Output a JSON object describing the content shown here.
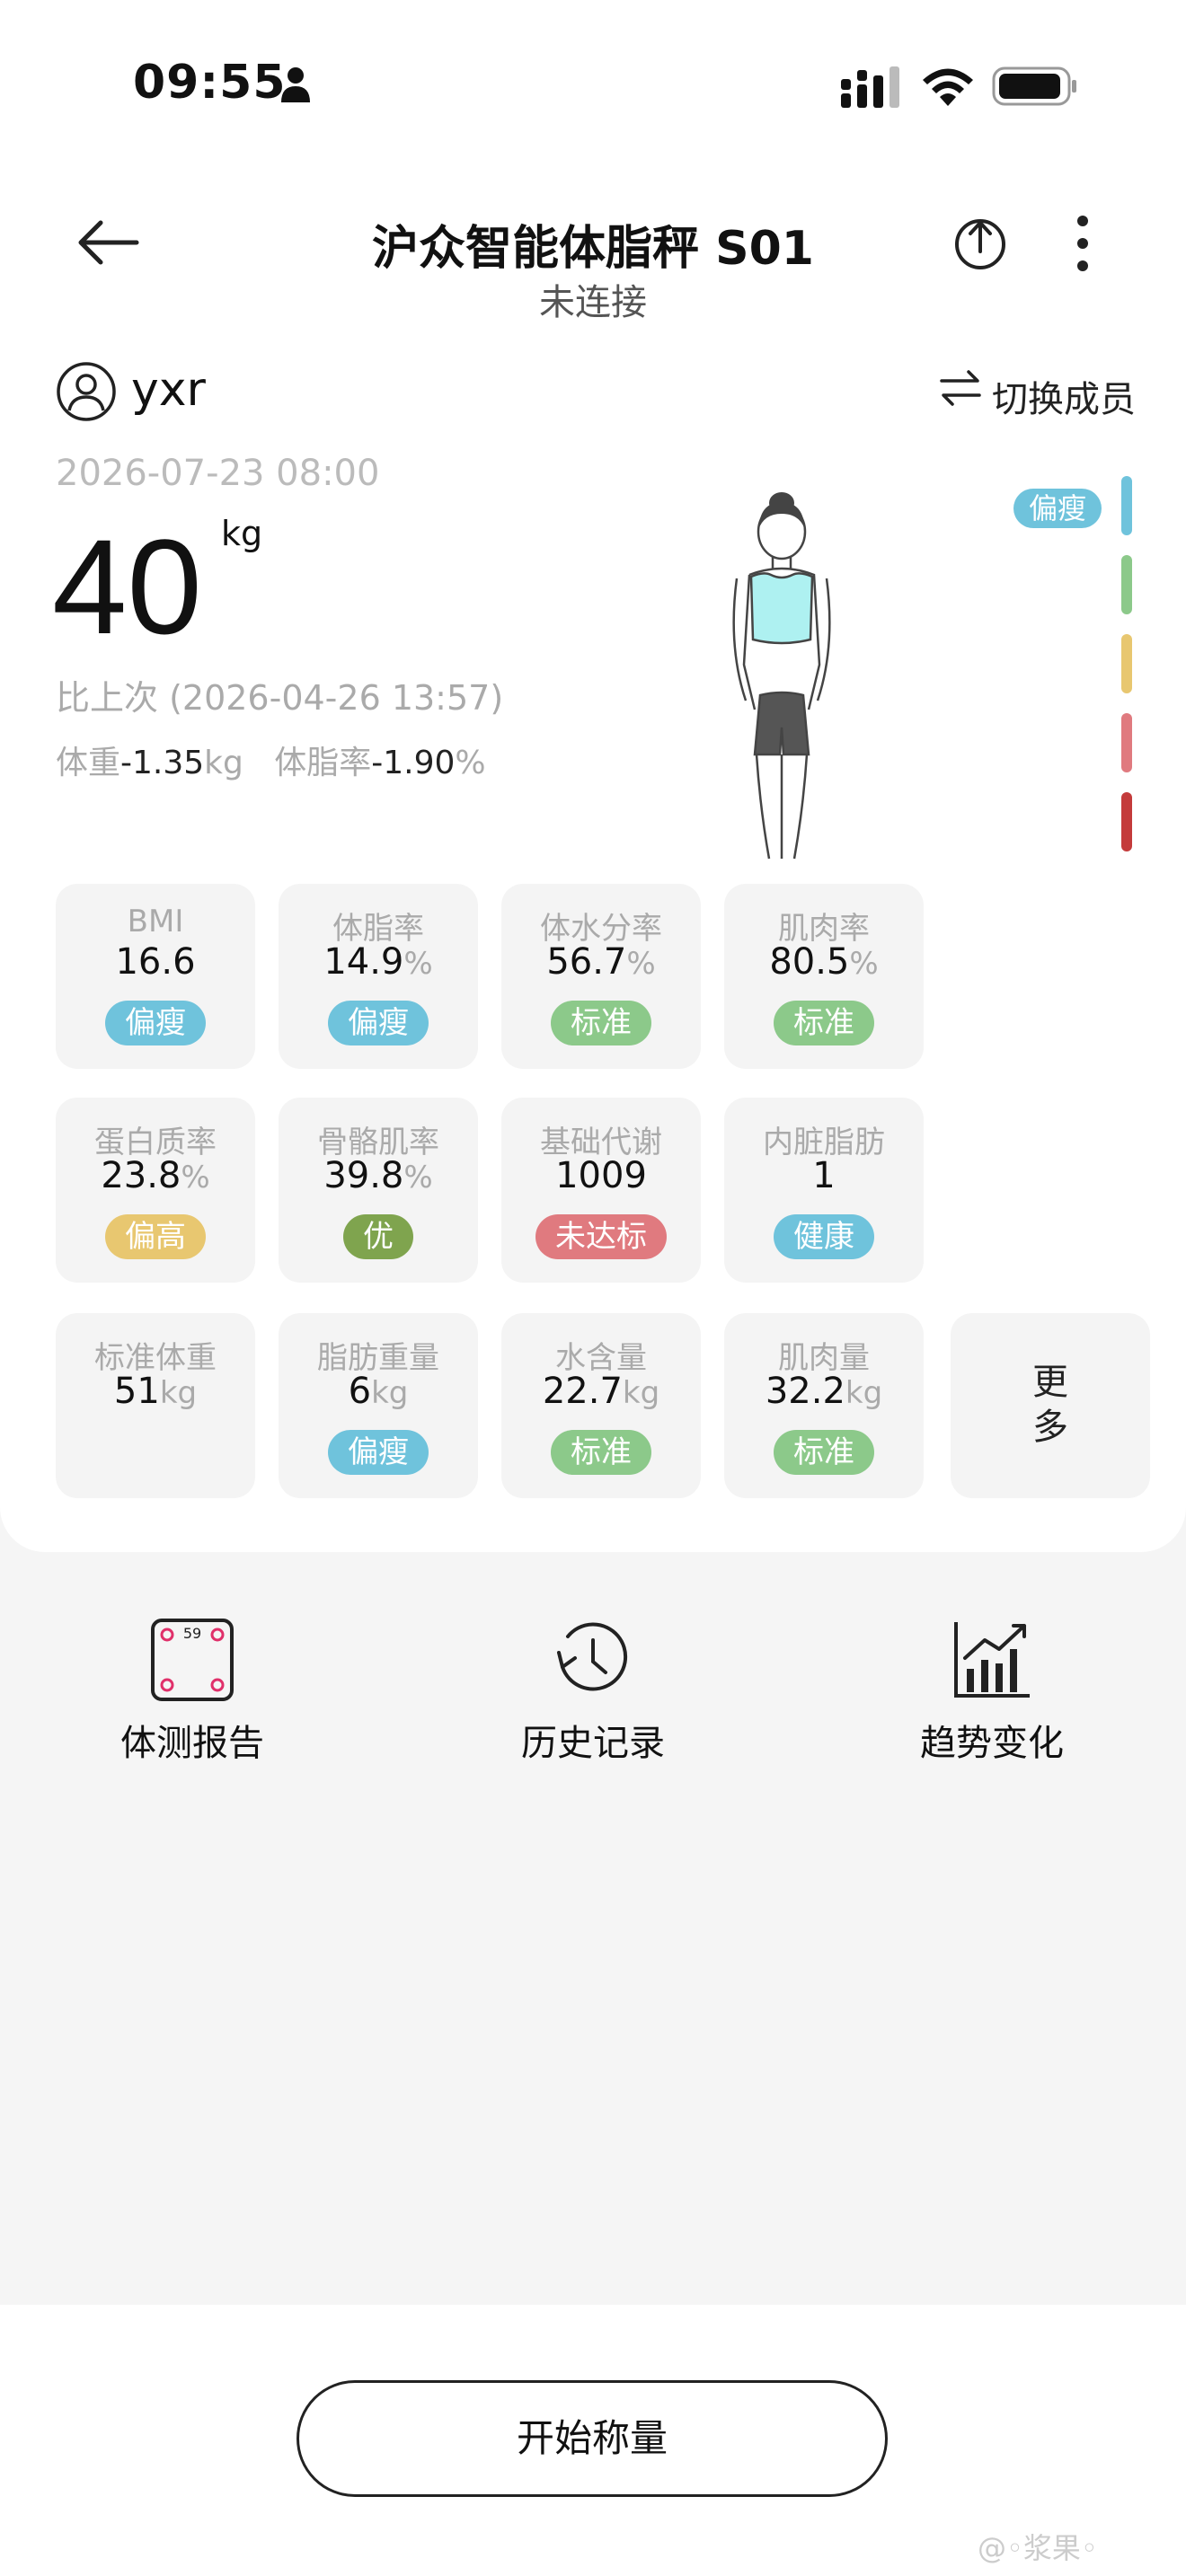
{
  "status_bar": {
    "time": "09:55"
  },
  "nav": {
    "title": "沪众智能体脂秤 S01",
    "subtitle": "未连接"
  },
  "user": {
    "name": "yxr",
    "switch_label": "切换成员"
  },
  "measurement": {
    "datetime": "2026-07-23 08:00",
    "weight": "40",
    "unit": "kg",
    "compare_text": "比上次 (2026-04-26 13:57)",
    "weight_delta_label": "体重",
    "weight_delta": "-1.35",
    "weight_delta_unit": "kg",
    "fat_delta_label": "体脂率",
    "fat_delta": "-1.90",
    "fat_delta_unit": "%",
    "body_type_tag": "偏瘦"
  },
  "level_colors": [
    "#6fc3dc",
    "#8cc98a",
    "#e8c770",
    "#e07a7f",
    "#c43b3b"
  ],
  "metrics": [
    {
      "label": "BMI",
      "value": "16.6",
      "unit": "",
      "tag": "偏瘦",
      "tag_color": "#6fc3dc"
    },
    {
      "label": "体脂率",
      "value": "14.9",
      "unit": "%",
      "tag": "偏瘦",
      "tag_color": "#6fc3dc"
    },
    {
      "label": "体水分率",
      "value": "56.7",
      "unit": "%",
      "tag": "标准",
      "tag_color": "#8cc98a"
    },
    {
      "label": "肌肉率",
      "value": "80.5",
      "unit": "%",
      "tag": "标准",
      "tag_color": "#8cc98a"
    },
    {
      "label": "蛋白质率",
      "value": "23.8",
      "unit": "%",
      "tag": "偏高",
      "tag_color": "#e8c770"
    },
    {
      "label": "骨骼肌率",
      "value": "39.8",
      "unit": "%",
      "tag": "优",
      "tag_color": "#7fa44e"
    },
    {
      "label": "基础代谢",
      "value": "1009",
      "unit": "",
      "tag": "未达标",
      "tag_color": "#e07a7f"
    },
    {
      "label": "内脏脂肪",
      "value": "1",
      "unit": "",
      "tag": "健康",
      "tag_color": "#6fc3dc"
    },
    {
      "label": "标准体重",
      "value": "51",
      "unit": "kg",
      "tag": "",
      "tag_color": ""
    },
    {
      "label": "脂肪重量",
      "value": "6",
      "unit": "kg",
      "tag": "偏瘦",
      "tag_color": "#6fc3dc"
    },
    {
      "label": "水含量",
      "value": "22.7",
      "unit": "kg",
      "tag": "标准",
      "tag_color": "#8cc98a"
    },
    {
      "label": "肌肉量",
      "value": "32.2",
      "unit": "kg",
      "tag": "标准",
      "tag_color": "#8cc98a"
    }
  ],
  "more_card": {
    "line1": "更",
    "line2": "多"
  },
  "shortcuts": {
    "report": {
      "label": "体测报告",
      "scale_display": "59"
    },
    "history": {
      "label": "历史记录"
    },
    "trend": {
      "label": "趋势变化"
    }
  },
  "start_button": "开始称量",
  "watermark": "@◦浆果◦"
}
